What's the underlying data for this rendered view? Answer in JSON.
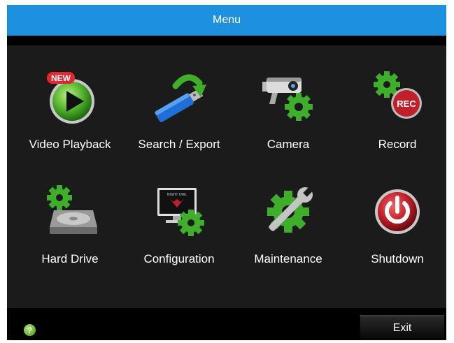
{
  "window": {
    "title": "Menu"
  },
  "menu": {
    "items": [
      {
        "label": "Video Playback",
        "icon": "video-playback-icon",
        "badge": "NEW"
      },
      {
        "label": "Search / Export",
        "icon": "usb-export-icon"
      },
      {
        "label": "Camera",
        "icon": "camera-gear-icon"
      },
      {
        "label": "Record",
        "icon": "record-gear-icon",
        "badge": "REC"
      },
      {
        "label": "Hard Drive",
        "icon": "hard-drive-gear-icon"
      },
      {
        "label": "Configuration",
        "icon": "configuration-monitor-icon",
        "monitor_text": "NIGHT OWL"
      },
      {
        "label": "Maintenance",
        "icon": "wrench-gear-icon"
      },
      {
        "label": "Shutdown",
        "icon": "power-icon"
      }
    ]
  },
  "footer": {
    "help_icon": "help-icon",
    "help_glyph": "?",
    "exit_label": "Exit"
  },
  "colors": {
    "title_bar": "#1e90e0",
    "panel": "#1b1b1b",
    "gear": "#3fae2a",
    "record_red": "#c0202a"
  }
}
